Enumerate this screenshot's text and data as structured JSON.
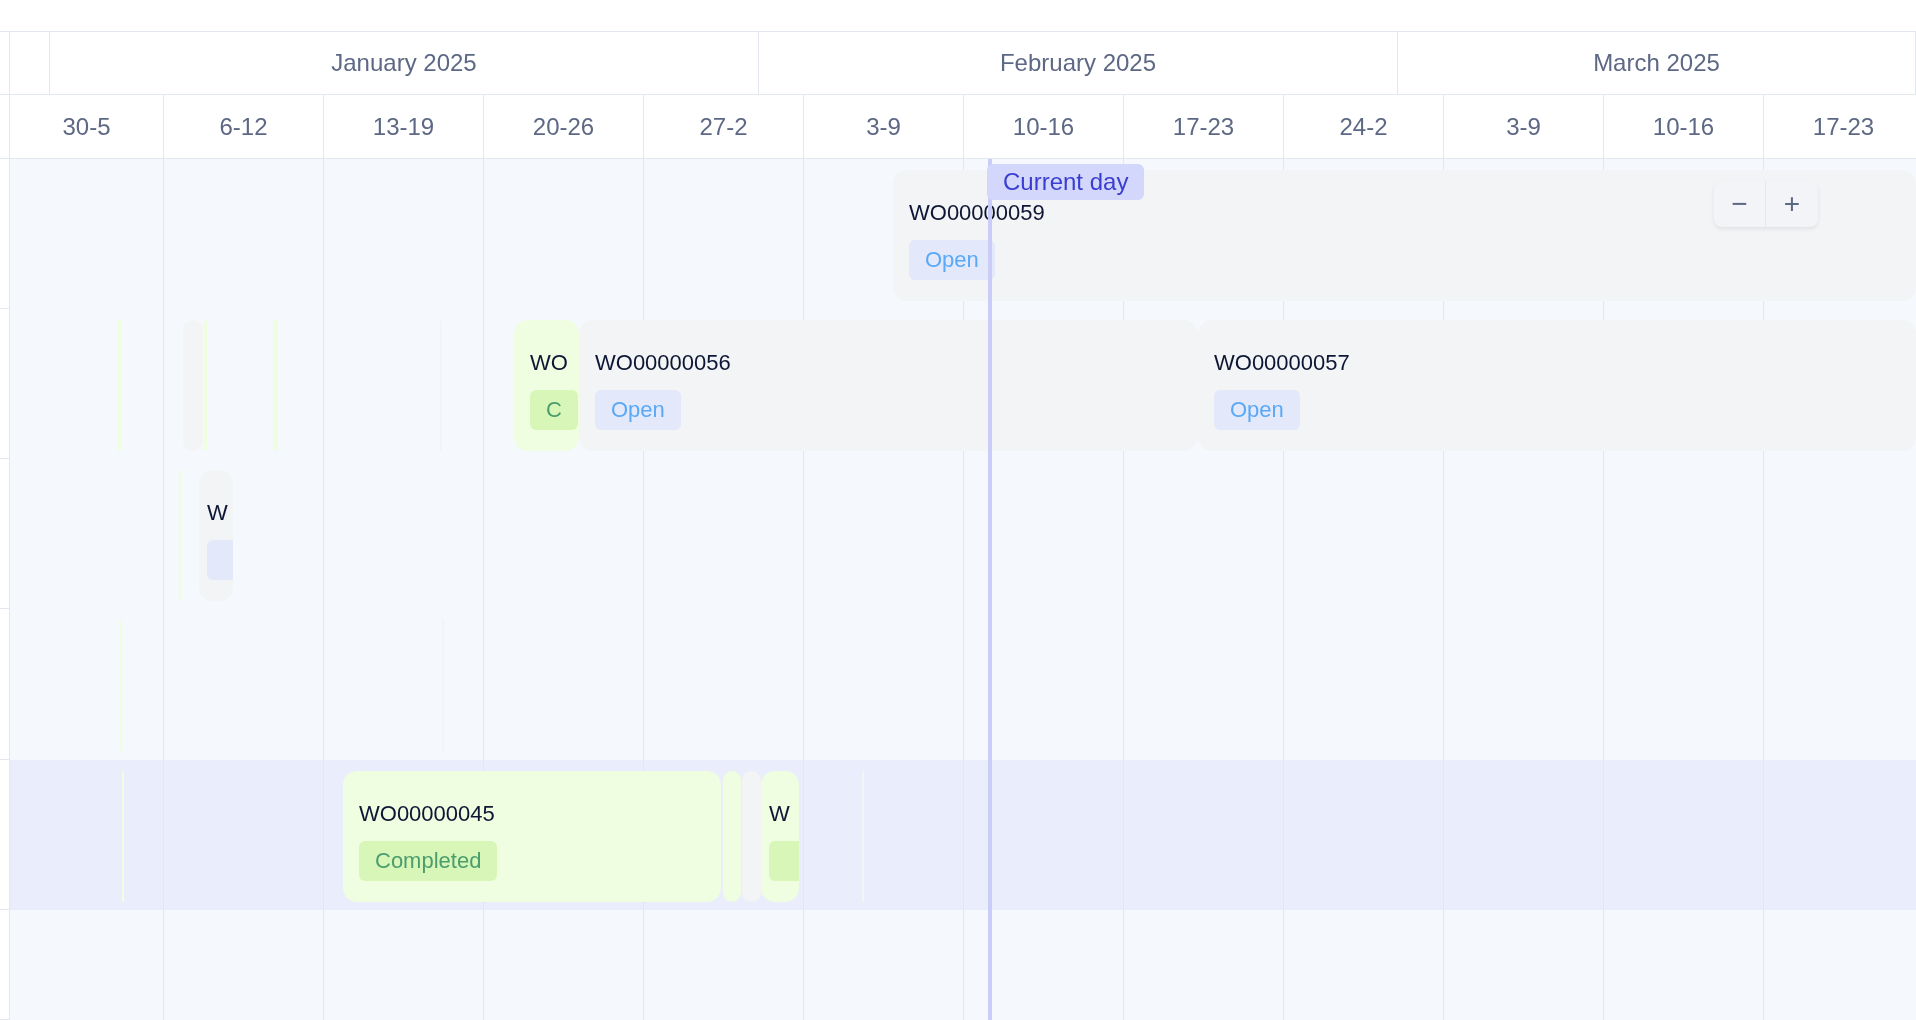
{
  "timeline": {
    "months": [
      "January 2025",
      "February 2025",
      "March 2025"
    ],
    "weeks": [
      "30-5",
      "6-12",
      "13-19",
      "20-26",
      "27-2",
      "3-9",
      "10-16",
      "17-23",
      "24-2",
      "3-9",
      "10-16",
      "17-23"
    ]
  },
  "current_day": {
    "label": "Current day"
  },
  "zoom_controls": [
    "−",
    "+"
  ],
  "rows": [
    {
      "selected": false,
      "bars": [
        {
          "kind": "open",
          "code": "WO00000059",
          "status": "Open"
        }
      ]
    },
    {
      "selected": false,
      "bars": [
        {
          "kind": "completed"
        },
        {
          "kind": "open"
        },
        {
          "kind": "completed"
        },
        {
          "kind": "completed"
        },
        {
          "kind": "open"
        },
        {
          "kind": "completed",
          "code": "WO",
          "status": "C"
        },
        {
          "kind": "open",
          "code": "WO00000056",
          "status": "Open"
        },
        {
          "kind": "open",
          "code": "WO00000057",
          "status": "Open"
        }
      ]
    },
    {
      "selected": false,
      "bars": [
        {
          "kind": "completed"
        },
        {
          "kind": "open",
          "code": "W"
        }
      ]
    },
    {
      "selected": false,
      "bars": [
        {
          "kind": "completed"
        },
        {
          "kind": "open"
        }
      ]
    },
    {
      "selected": true,
      "bars": [
        {
          "kind": "completed"
        },
        {
          "kind": "completed",
          "code": "WO00000045",
          "status": "Completed"
        },
        {
          "kind": "completed"
        },
        {
          "kind": "open"
        },
        {
          "kind": "completed",
          "code": "W"
        },
        {
          "kind": "open"
        }
      ]
    },
    {
      "selected": false
    }
  ]
}
